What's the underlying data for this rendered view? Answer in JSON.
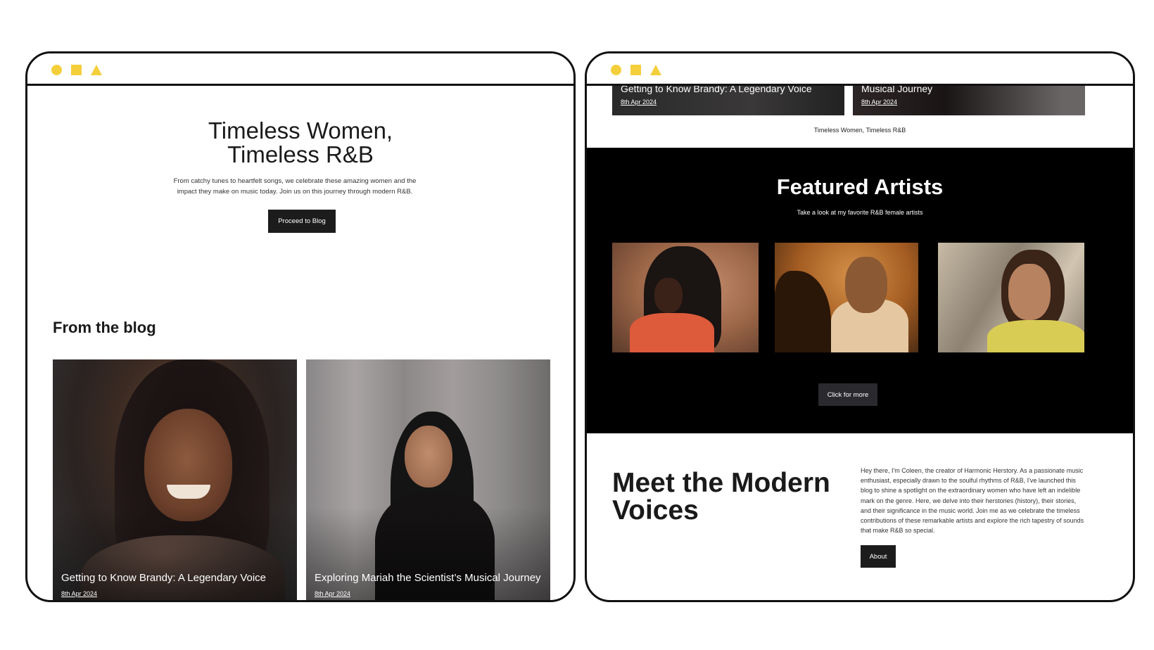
{
  "left_window": {
    "hero": {
      "title": "Timeless Women, Timeless R&B",
      "subtitle": "From catchy tunes to heartfelt songs, we celebrate these amazing women and the impact they make on music today. Join us on this journey through modern R&B.",
      "button": "Proceed to Blog"
    },
    "blog": {
      "heading": "From the blog",
      "posts": [
        {
          "title": "Getting to Know Brandy: A Legendary Voice",
          "date": "8th Apr 2024"
        },
        {
          "title": "Exploring Mariah the Scientist’s Musical Journey",
          "date": "8th Apr 2024"
        }
      ]
    }
  },
  "right_window": {
    "partial_posts": [
      {
        "title": "Getting to Know Brandy: A Legendary Voice",
        "date": "8th Apr 2024"
      },
      {
        "title": "Musical Journey",
        "date": "8th Apr 2024"
      }
    ],
    "caption": "Timeless Women, Timeless R&B",
    "featured": {
      "title": "Featured Artists",
      "subtitle": "Take a look at my favorite R&B female artists",
      "button": "Click for more"
    },
    "meet": {
      "title": "Meet the Modern Voices",
      "body": "Hey there, I'm Coleen, the creator of Harmonic Herstory. As a passionate music enthusiast, especially drawn to the soulful rhythms of R&B, I've launched this blog to shine a spotlight on the extraordinary women who have left an indelible mark on the genre. Here, we delve into their herstories (history), their stories, and their significance in the music world. Join me as we celebrate the timeless contributions of these remarkable artists and explore the rich tapestry of sounds that make R&B so special.",
      "button": "About"
    }
  },
  "colors": {
    "accent_yellow": "#f4cf3c",
    "dark": "#1c1c1c",
    "featured_bg": "#000000"
  }
}
